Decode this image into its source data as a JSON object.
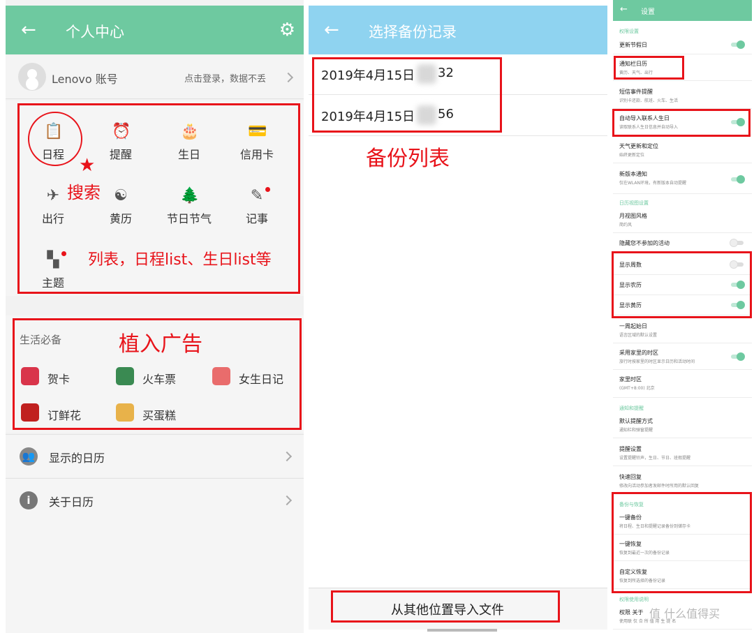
{
  "panel1": {
    "title": "个人中心",
    "account_name": "Lenovo 账号",
    "account_hint": "点击登录，数据不丢",
    "grid": [
      {
        "label": "日程",
        "icon": "clipboard-icon"
      },
      {
        "label": "提醒",
        "icon": "alarm-clock-icon"
      },
      {
        "label": "生日",
        "icon": "cake-icon"
      },
      {
        "label": "信用卡",
        "icon": "credit-card-icon"
      },
      {
        "label": "出行",
        "icon": "airplane-icon"
      },
      {
        "label": "黄历",
        "icon": "yin-yang-icon"
      },
      {
        "label": "节日节气",
        "icon": "tree-icon"
      },
      {
        "label": "记事",
        "icon": "pen-icon"
      },
      {
        "label": "主题",
        "icon": "theme-icon"
      }
    ],
    "life_section": "生活必备",
    "life_items": [
      {
        "label": "贺卡",
        "color": "#d9344a"
      },
      {
        "label": "火车票",
        "color": "#3a8a52"
      },
      {
        "label": "女生日记",
        "color": "#e96c6c"
      },
      {
        "label": "订鲜花",
        "color": "#c0201f"
      },
      {
        "label": "买蛋糕",
        "color": "#e8b24a"
      }
    ],
    "rows": [
      {
        "label": "显示的日历",
        "icon": "people-icon"
      },
      {
        "label": "关于日历",
        "icon": "info-icon"
      }
    ],
    "annotations": {
      "search": "搜索",
      "list": "列表，日程list、生日list等",
      "ads": "植入广告"
    }
  },
  "panel2": {
    "title": "选择备份记录",
    "backups": [
      {
        "prefix": "2019年4月15日",
        "suffix": "32"
      },
      {
        "prefix": "2019年4月15日",
        "suffix": "56"
      }
    ],
    "import_button": "从其他位置导入文件",
    "annotation": "备份列表"
  },
  "panel3": {
    "title": "设置",
    "sections": {
      "permissions": "权限设置",
      "calendar_view": "日历视图设置",
      "notify": "通知和提醒",
      "backup": "备份与恢复",
      "permission_usage": "权限使用说明"
    },
    "rows": [
      {
        "title": "更新节假日",
        "desc": "",
        "toggle": "on"
      },
      {
        "title": "通知栏日历",
        "desc": "黄历、天气、出行",
        "toggle": ""
      },
      {
        "title": "短信事件提醒",
        "desc": "识别卡还款、航班、火车、生活",
        "toggle": ""
      },
      {
        "title": "自动导入联系人生日",
        "desc": "读取联系人生日信息并自动导入",
        "toggle": "on"
      },
      {
        "title": "天气更新和定位",
        "desc": "始终更新定位",
        "toggle": ""
      },
      {
        "title": "新版本通知",
        "desc": "仅在WLAN环境，有新版本自动提醒",
        "toggle": "on"
      },
      {
        "title": "月视图风格",
        "desc": "简约风",
        "toggle": ""
      },
      {
        "title": "隐藏您不参加的活动",
        "desc": "",
        "toggle": "off"
      },
      {
        "title": "显示周数",
        "desc": "",
        "toggle": "off"
      },
      {
        "title": "显示农历",
        "desc": "",
        "toggle": "on"
      },
      {
        "title": "显示黄历",
        "desc": "",
        "toggle": "on"
      },
      {
        "title": "一周起始日",
        "desc": "语言区域的默认设置",
        "toggle": ""
      },
      {
        "title": "采用家里的时区",
        "desc": "旅行时按家里的时区显示日历和活动时间",
        "toggle": "on"
      },
      {
        "title": "家里时区",
        "desc": "(GMT+8:00) 北京",
        "toggle": ""
      },
      {
        "title": "默认提醒方式",
        "desc": "通知栏和弹窗提醒",
        "toggle": ""
      },
      {
        "title": "提醒设置",
        "desc": "设置提醒铃声，生日、节日、班假提醒",
        "toggle": ""
      },
      {
        "title": "快速回复",
        "desc": "修改向活动参加者发邮件时所用的默认回复",
        "toggle": ""
      },
      {
        "title": "一键备份",
        "desc": "将日程、生日和提醒记录备份到储存卡",
        "toggle": ""
      },
      {
        "title": "一键恢复",
        "desc": "恢复到最近一次的备份记录",
        "toggle": ""
      },
      {
        "title": "自定义恢复",
        "desc": "恢复到所选择的备份记录",
        "toggle": ""
      },
      {
        "title": "权限 关于",
        "desc": "使用联 仅 合 所 值 用 生 提 名",
        "toggle": ""
      }
    ],
    "accent_color": "#6ec9a0"
  },
  "watermark": "值 什么值得买"
}
